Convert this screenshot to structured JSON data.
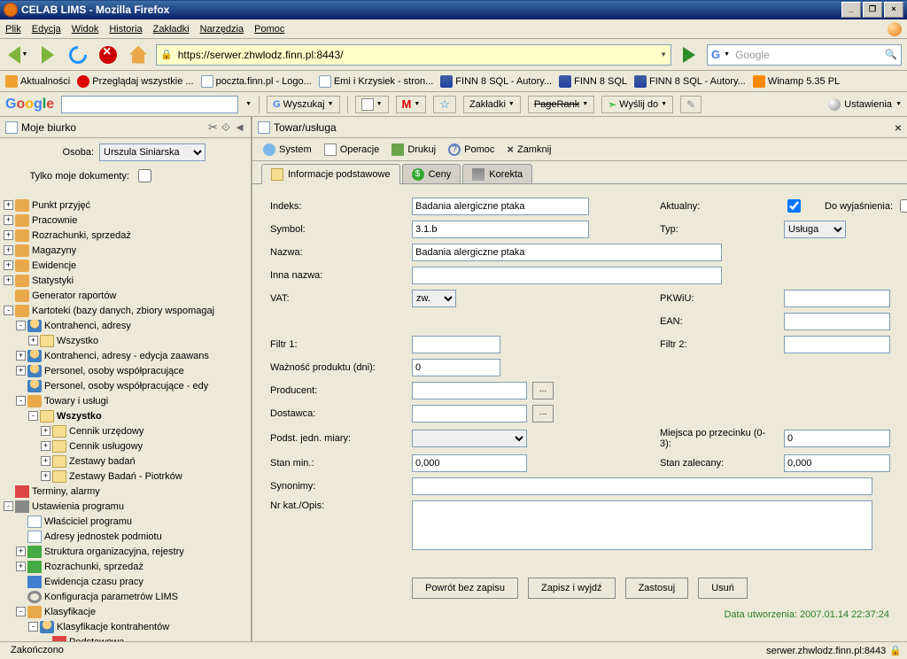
{
  "app": {
    "title": "CELAB LIMS - Mozilla Firefox"
  },
  "menu": [
    "Plik",
    "Edycja",
    "Widok",
    "Historia",
    "Zakładki",
    "Narzędzia",
    "Pomoc"
  ],
  "url": "https://serwer.zhwlodz.finn.pl:8443/",
  "search_placeholder": "Google",
  "bookmarks": [
    {
      "label": "Aktualności"
    },
    {
      "label": "Przeglądaj wszystkie ..."
    },
    {
      "label": "poczta.finn.pl - Logo..."
    },
    {
      "label": "Emi i Krzysiek - stron..."
    },
    {
      "label": "FINN 8 SQL - Autory..."
    },
    {
      "label": "FINN 8 SQL"
    },
    {
      "label": "FINN 8 SQL - Autory..."
    },
    {
      "label": "Winamp 5.35 PL"
    }
  ],
  "googlebar": {
    "search_label": "Wyszukaj",
    "bookmarks_label": "Zakładki",
    "pagerank_label": "PageRank",
    "send_label": "Wyślij do",
    "settings_label": "Ustawienia"
  },
  "sidebar": {
    "title": "Moje biurko",
    "person_label": "Osoba:",
    "person_value": "Urszula Siniarska",
    "mydocs_label": "Tylko moje dokumenty:",
    "tree": [
      {
        "d": 0,
        "e": "+",
        "i": "generic",
        "t": "Punkt przyjęć"
      },
      {
        "d": 0,
        "e": "+",
        "i": "generic",
        "t": "Pracownie"
      },
      {
        "d": 0,
        "e": "+",
        "i": "generic",
        "t": "Rozrachunki, sprzedaż"
      },
      {
        "d": 0,
        "e": "+",
        "i": "generic",
        "t": "Magazyny"
      },
      {
        "d": 0,
        "e": "+",
        "i": "generic",
        "t": "Ewidencje"
      },
      {
        "d": 0,
        "e": "+",
        "i": "generic",
        "t": "Statystyki"
      },
      {
        "d": 0,
        "e": " ",
        "i": "generic",
        "t": "Generator raportów"
      },
      {
        "d": 0,
        "e": "-",
        "i": "generic",
        "t": "Kartoteki (bazy danych, zbiory wspomagaj"
      },
      {
        "d": 1,
        "e": "-",
        "i": "person",
        "t": "Kontrahenci, adresy"
      },
      {
        "d": 2,
        "e": "+",
        "i": "folder",
        "t": "Wszystko"
      },
      {
        "d": 1,
        "e": "+",
        "i": "person",
        "t": "Kontrahenci, adresy - edycja zaawans"
      },
      {
        "d": 1,
        "e": "+",
        "i": "person",
        "t": "Personel, osoby współpracujące"
      },
      {
        "d": 1,
        "e": " ",
        "i": "person",
        "t": "Personel, osoby współpracujące - edy"
      },
      {
        "d": 1,
        "e": "-",
        "i": "generic",
        "t": "Towary i usługi"
      },
      {
        "d": 2,
        "e": "-",
        "i": "folder",
        "t": "Wszystko",
        "b": true
      },
      {
        "d": 3,
        "e": "+",
        "i": "folder",
        "t": "Cennik urzędowy"
      },
      {
        "d": 3,
        "e": "+",
        "i": "folder",
        "t": "Cennik usługowy"
      },
      {
        "d": 3,
        "e": "+",
        "i": "folder",
        "t": "Zestawy badań"
      },
      {
        "d": 3,
        "e": "+",
        "i": "folder",
        "t": "Zestawy Badań - Piotrków"
      },
      {
        "d": 0,
        "e": " ",
        "i": "red",
        "t": "Terminy, alarmy"
      },
      {
        "d": 0,
        "e": "-",
        "i": "cross",
        "t": "Ustawienia programu"
      },
      {
        "d": 1,
        "e": " ",
        "i": "doc",
        "t": "Właściciel programu"
      },
      {
        "d": 1,
        "e": " ",
        "i": "doc",
        "t": "Adresy jednostek podmiotu"
      },
      {
        "d": 1,
        "e": "+",
        "i": "green",
        "t": "Struktura organizacyjna, rejestry"
      },
      {
        "d": 1,
        "e": "+",
        "i": "green",
        "t": "Rozrachunki, sprzedaż"
      },
      {
        "d": 1,
        "e": " ",
        "i": "blue",
        "t": "Ewidencja czasu pracy"
      },
      {
        "d": 1,
        "e": " ",
        "i": "gear",
        "t": "Konfiguracja parametrów LIMS"
      },
      {
        "d": 1,
        "e": "-",
        "i": "generic",
        "t": "Klasyfikacje"
      },
      {
        "d": 2,
        "e": "-",
        "i": "person",
        "t": "Klasyfikacje kontrahentów"
      },
      {
        "d": 3,
        "e": " ",
        "i": "red",
        "t": "Podstawowa"
      }
    ]
  },
  "content": {
    "title": "Towar/usługa",
    "toolbar": [
      {
        "id": "system",
        "label": "System"
      },
      {
        "id": "operacje",
        "label": "Operacje"
      },
      {
        "id": "drukuj",
        "label": "Drukuj"
      },
      {
        "id": "pomoc",
        "label": "Pomoc"
      },
      {
        "id": "zamknij",
        "label": "Zamknij"
      }
    ],
    "tabs": [
      {
        "id": "info",
        "label": "Informacje podstawowe",
        "active": true
      },
      {
        "id": "ceny",
        "label": "Ceny",
        "active": false
      },
      {
        "id": "korekta",
        "label": "Korekta",
        "active": false
      }
    ],
    "fields": {
      "indeks_label": "Indeks:",
      "indeks": "Badania alergiczne ptaka",
      "aktualny_label": "Aktualny:",
      "aktualny": true,
      "dowyjas_label": "Do wyjaśnienia:",
      "dowyjas": false,
      "symbol_label": "Symbol:",
      "symbol": "3.1.b",
      "typ_label": "Typ:",
      "typ": "Usługa",
      "nazwa_label": "Nazwa:",
      "nazwa": "Badania alergiczne ptaka",
      "innanazwa_label": "Inna nazwa:",
      "innanazwa": "",
      "vat_label": "VAT:",
      "vat": "zw.",
      "pkwiu_label": "PKWiU:",
      "pkwiu": "",
      "ean_label": "EAN:",
      "ean": "",
      "filtr1_label": "Filtr 1:",
      "filtr1": "",
      "filtr2_label": "Filtr 2:",
      "filtr2": "",
      "waznosc_label": "Ważność produktu (dni):",
      "waznosc": "0",
      "producent_label": "Producent:",
      "producent": "",
      "dostawca_label": "Dostawca:",
      "dostawca": "",
      "pjm_label": "Podst. jedn. miary:",
      "pjm": "",
      "mpp_label": "Miejsca po przecinku (0-3):",
      "mpp": "0",
      "stanmin_label": "Stan min.:",
      "stanmin": "0,000",
      "stanzal_label": "Stan zalecany:",
      "stanzal": "0,000",
      "synonimy_label": "Synonimy:",
      "synonimy": "",
      "nrkat_label": "Nr kat./Opis:",
      "nrkat": ""
    },
    "buttons": {
      "return": "Powrót bez zapisu",
      "save_exit": "Zapisz i wyjdź",
      "apply": "Zastosuj",
      "delete": "Usuń"
    },
    "created": "Data utworzenia: 2007.01.14 22:37:24"
  },
  "status": {
    "left": "Zakończono",
    "right": "serwer.zhwlodz.finn.pl:8443"
  }
}
